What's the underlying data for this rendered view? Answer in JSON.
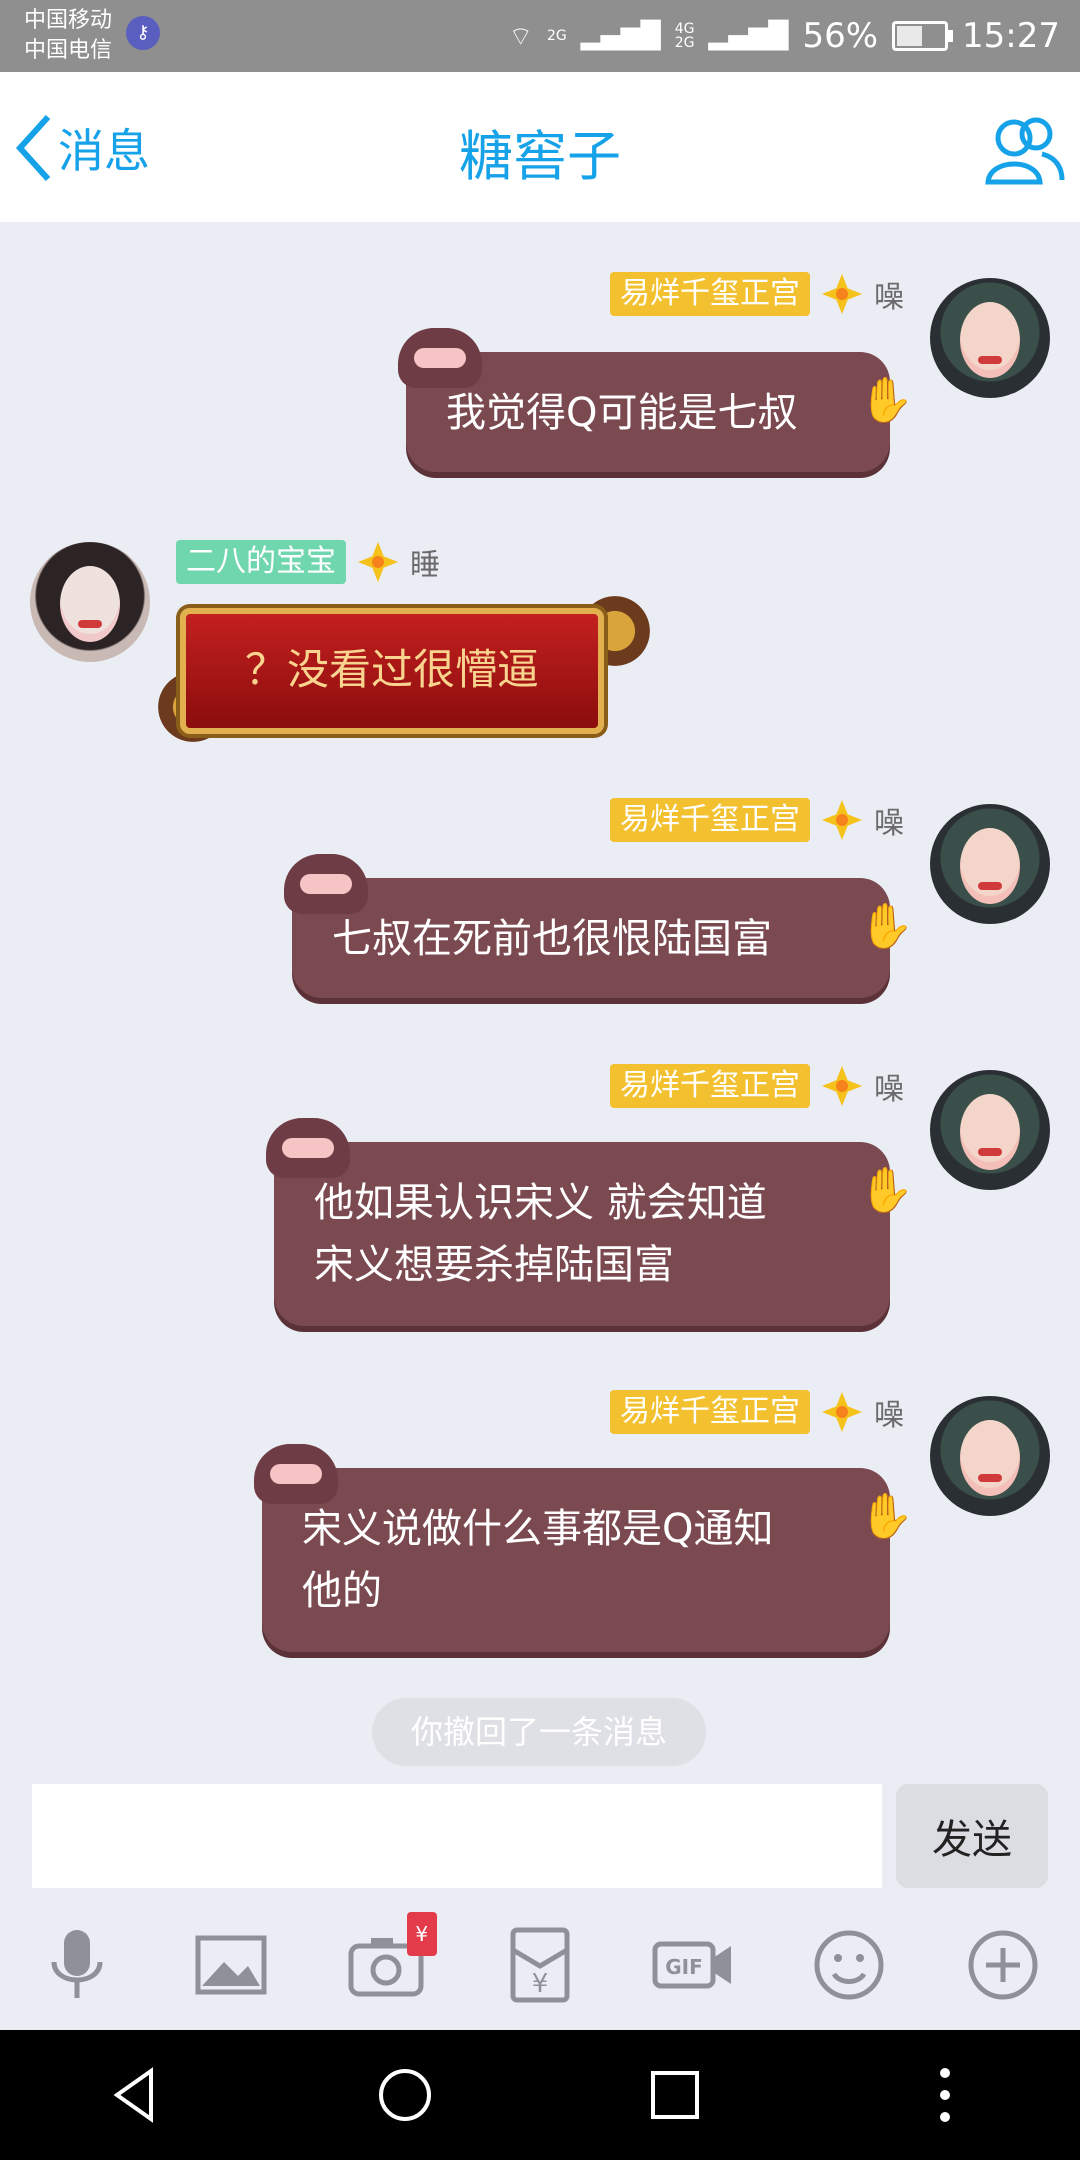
{
  "status_bar": {
    "carrier1": "中国移动",
    "carrier2": "中国电信",
    "net1": "2G",
    "net2": "4G\n2G",
    "battery": "56%",
    "battery_level": 0.56,
    "time": "15:27"
  },
  "header": {
    "back_label": "消息",
    "title": "糖窖子",
    "accent": "#16a2e8"
  },
  "messages": [
    {
      "side": "right",
      "tag": "易烊千玺正宫",
      "status": "噪",
      "text": "我觉得Q可能是七叔"
    },
    {
      "side": "left",
      "tag": "二八的宝宝",
      "status": "睡",
      "text": "？没看过很懵逼"
    },
    {
      "side": "right",
      "tag": "易烊千玺正宫",
      "status": "噪",
      "text": "七叔在死前也很恨陆国富"
    },
    {
      "side": "right",
      "tag": "易烊千玺正宫",
      "status": "噪",
      "text": "他如果认识宋义 就会知道\n宋义想要杀掉陆国富"
    },
    {
      "side": "right",
      "tag": "易烊千玺正宫",
      "status": "噪",
      "text": "宋义说做什么事都是Q通知\n他的"
    }
  ],
  "recall_notice": "你撤回了一条消息",
  "input": {
    "placeholder": "",
    "send_label": "发送"
  },
  "toolbar": {
    "icons": [
      "microphone-icon",
      "image-icon",
      "camera-icon",
      "red-packet-icon",
      "gif-icon",
      "emoji-icon",
      "plus-icon"
    ],
    "camera_badge": "¥"
  },
  "navbar": {
    "icons": [
      "back-triangle-icon",
      "home-circle-icon",
      "recents-square-icon",
      "more-vert-icon"
    ]
  }
}
